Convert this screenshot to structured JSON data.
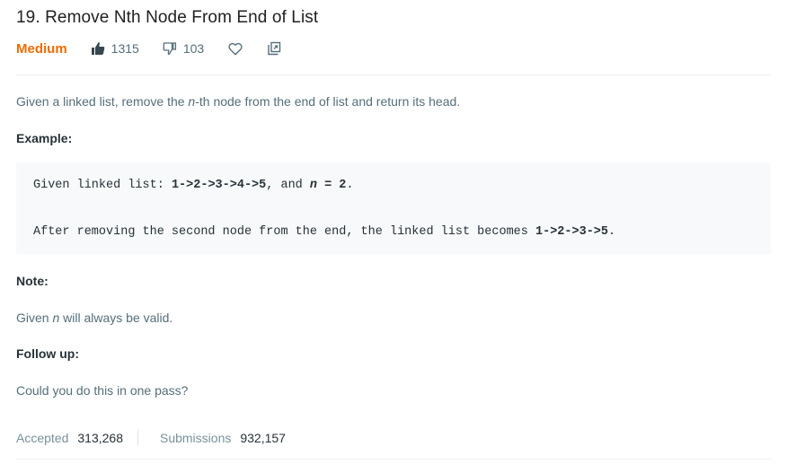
{
  "problem": {
    "title": "19. Remove Nth Node From End of List",
    "difficulty": "Medium",
    "likes": "1315",
    "dislikes": "103"
  },
  "description": {
    "before": "Given a linked list, remove the ",
    "var": "n",
    "after": "-th node from the end of list and return its head."
  },
  "example": {
    "heading": "Example:",
    "line1_prefix": "Given linked list: ",
    "line1_list": "1->2->3->4->5",
    "line1_mid": ", and ",
    "line1_var": "n",
    "line1_eq": " = 2",
    "line1_end": ".",
    "line2_prefix": "After removing the second node from the end, the linked list becomes ",
    "line2_list": "1->2->3->5",
    "line2_end": "."
  },
  "note": {
    "heading": "Note:",
    "before": "Given ",
    "var": "n",
    "after": " will always be valid."
  },
  "follow_up": {
    "heading": "Follow up:",
    "text": "Could you do this in one pass?"
  },
  "stats": {
    "accepted_label": "Accepted",
    "accepted_value": "313,268",
    "submissions_label": "Submissions",
    "submissions_value": "932,157"
  },
  "icons": {
    "like": "thumbs-up-icon",
    "dislike": "thumbs-down-icon",
    "favorite": "heart-icon",
    "share": "share-icon"
  },
  "colors": {
    "difficulty": "#ef6c00",
    "muted_text": "#546e7a",
    "code_bg": "#f7f9fa"
  }
}
